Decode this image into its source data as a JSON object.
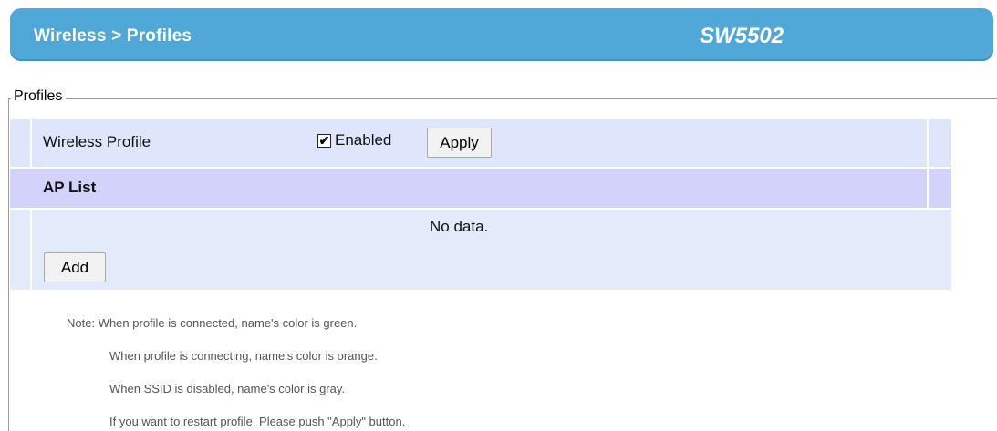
{
  "header": {
    "title": "Wireless > Profiles",
    "model": "SW5502"
  },
  "profiles_section": {
    "legend": "Profiles",
    "wireless_profile": {
      "label": "Wireless Profile",
      "enabled_checked": true,
      "enabled_label": "Enabled",
      "apply_label": "Apply"
    },
    "ap_list": {
      "label": "AP List",
      "empty_text": "No data.",
      "add_label": "Add"
    }
  },
  "notes": [
    "Note: When profile is connected, name's color is green.",
    "When profile is connecting, name's color is orange.",
    "When SSID is disabled, name's color is gray.",
    "If you want to restart profile. Please push \"Apply\" button."
  ],
  "colors": {
    "header_bg": "#4fa8d8",
    "profile_row_bg": "#dfe6fb",
    "aplist_row_bg": "#d3d2fa",
    "data_row_bg": "#e3ebfb"
  }
}
